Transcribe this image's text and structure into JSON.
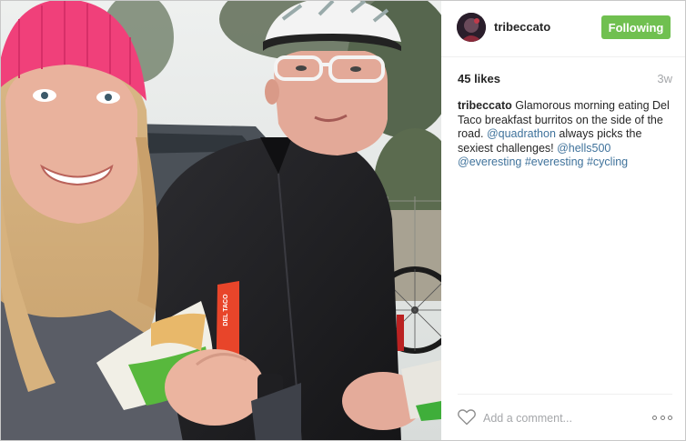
{
  "photo": {
    "alt": "Selfie of two cyclists eating breakfast burritos at roadside",
    "hot_sauce_label": "DEL TACO"
  },
  "header": {
    "username": "tribeccato",
    "follow_label": "Following",
    "accent_color": "#70c050"
  },
  "stats": {
    "likes": "45 likes",
    "time_ago": "3w"
  },
  "caption": {
    "user": "tribeccato",
    "text_1": " Glamorous morning eating Del Taco breakfast burritos on the side of the road. ",
    "mention_1": "@quadrathon",
    "text_2": " always picks the sexiest challenges! ",
    "mention_2": "@hells500",
    "text_3": " ",
    "mention_3": "@everesting",
    "text_4": " ",
    "hashtag_1": "#everesting",
    "text_5": " ",
    "hashtag_2": "#cycling",
    "link_color": "#3f729b"
  },
  "comment": {
    "placeholder": "Add a comment..."
  },
  "icons": {
    "like": "heart-icon",
    "more": "more-options-icon"
  }
}
